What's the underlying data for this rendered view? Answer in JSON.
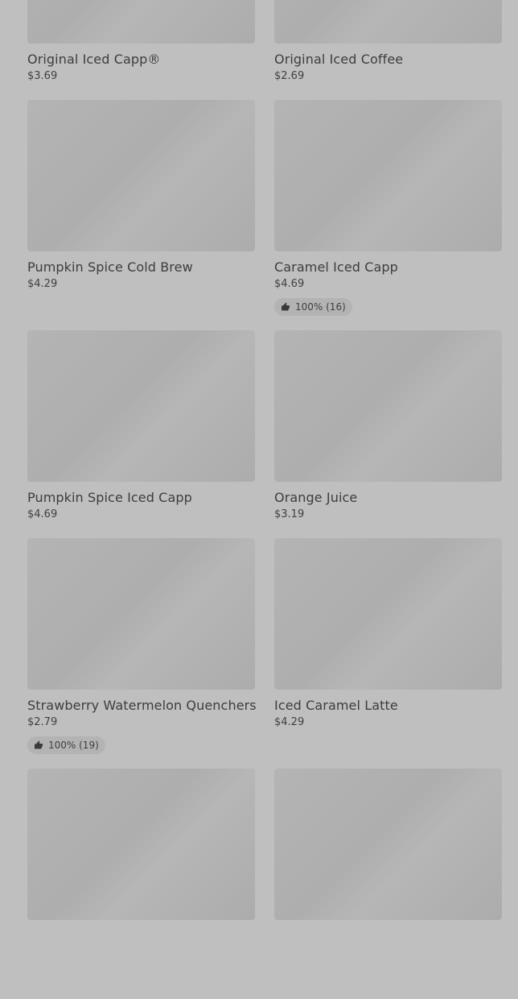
{
  "items": [
    {
      "name": "Original Iced Capp®",
      "price": "$3.69"
    },
    {
      "name": "Original Iced Coffee",
      "price": "$2.69"
    },
    {
      "name": "Pumpkin Spice Cold Brew",
      "price": "$4.29"
    },
    {
      "name": "Caramel Iced Capp",
      "price": "$4.69",
      "rating": "100% (16)"
    },
    {
      "name": "Pumpkin Spice Iced Capp",
      "price": "$4.69"
    },
    {
      "name": "Orange Juice",
      "price": "$3.19"
    },
    {
      "name": "Strawberry Watermelon Quenchers",
      "price": "$2.79",
      "rating": "100% (19)"
    },
    {
      "name": "Iced Caramel Latte",
      "price": "$4.29"
    }
  ],
  "icons": {
    "rating": "thumbs-up-icon"
  }
}
